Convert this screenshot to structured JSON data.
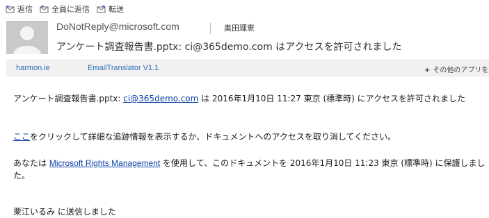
{
  "toolbar": {
    "reply_label": "返信",
    "reply_all_label": "全員に返信",
    "forward_label": "転送"
  },
  "header": {
    "sender": "DoNotReply@microsoft.com",
    "recipient": "奥田理恵",
    "subject": "アンケート調査報告書.pptx: ci@365demo.com はアクセスを許可されました"
  },
  "apps_bar": {
    "app1": "harmon.ie",
    "app2": "EmailTranslator V1.1",
    "more_apps": "その他のアプリを"
  },
  "body": {
    "p1_prefix": "アンケート調査報告書.pptx: ",
    "p1_link": "ci@365demo.com",
    "p1_suffix": " は 2016年1月10日 11:27 東京 (標準時) にアクセスを許可されました",
    "p2_link": "ここ",
    "p2_suffix": "をクリックして詳細な追跡情報を表示するか、ドキュメントへのアクセスを取り消してください。",
    "p3_prefix": "あなたは ",
    "p3_link": "Microsoft Rights Management",
    "p3_suffix": " を使用して、このドキュメントを 2016年1月10日 11:23 東京 (標準時) に保護しました。",
    "p4": "栗江いるみ に送信しました"
  },
  "colors": {
    "link": "#0b3fa8",
    "app_tab": "#2a6fb6",
    "apps_bar_bg": "#f1f1f1",
    "avatar_bg": "#c9c9c9"
  }
}
